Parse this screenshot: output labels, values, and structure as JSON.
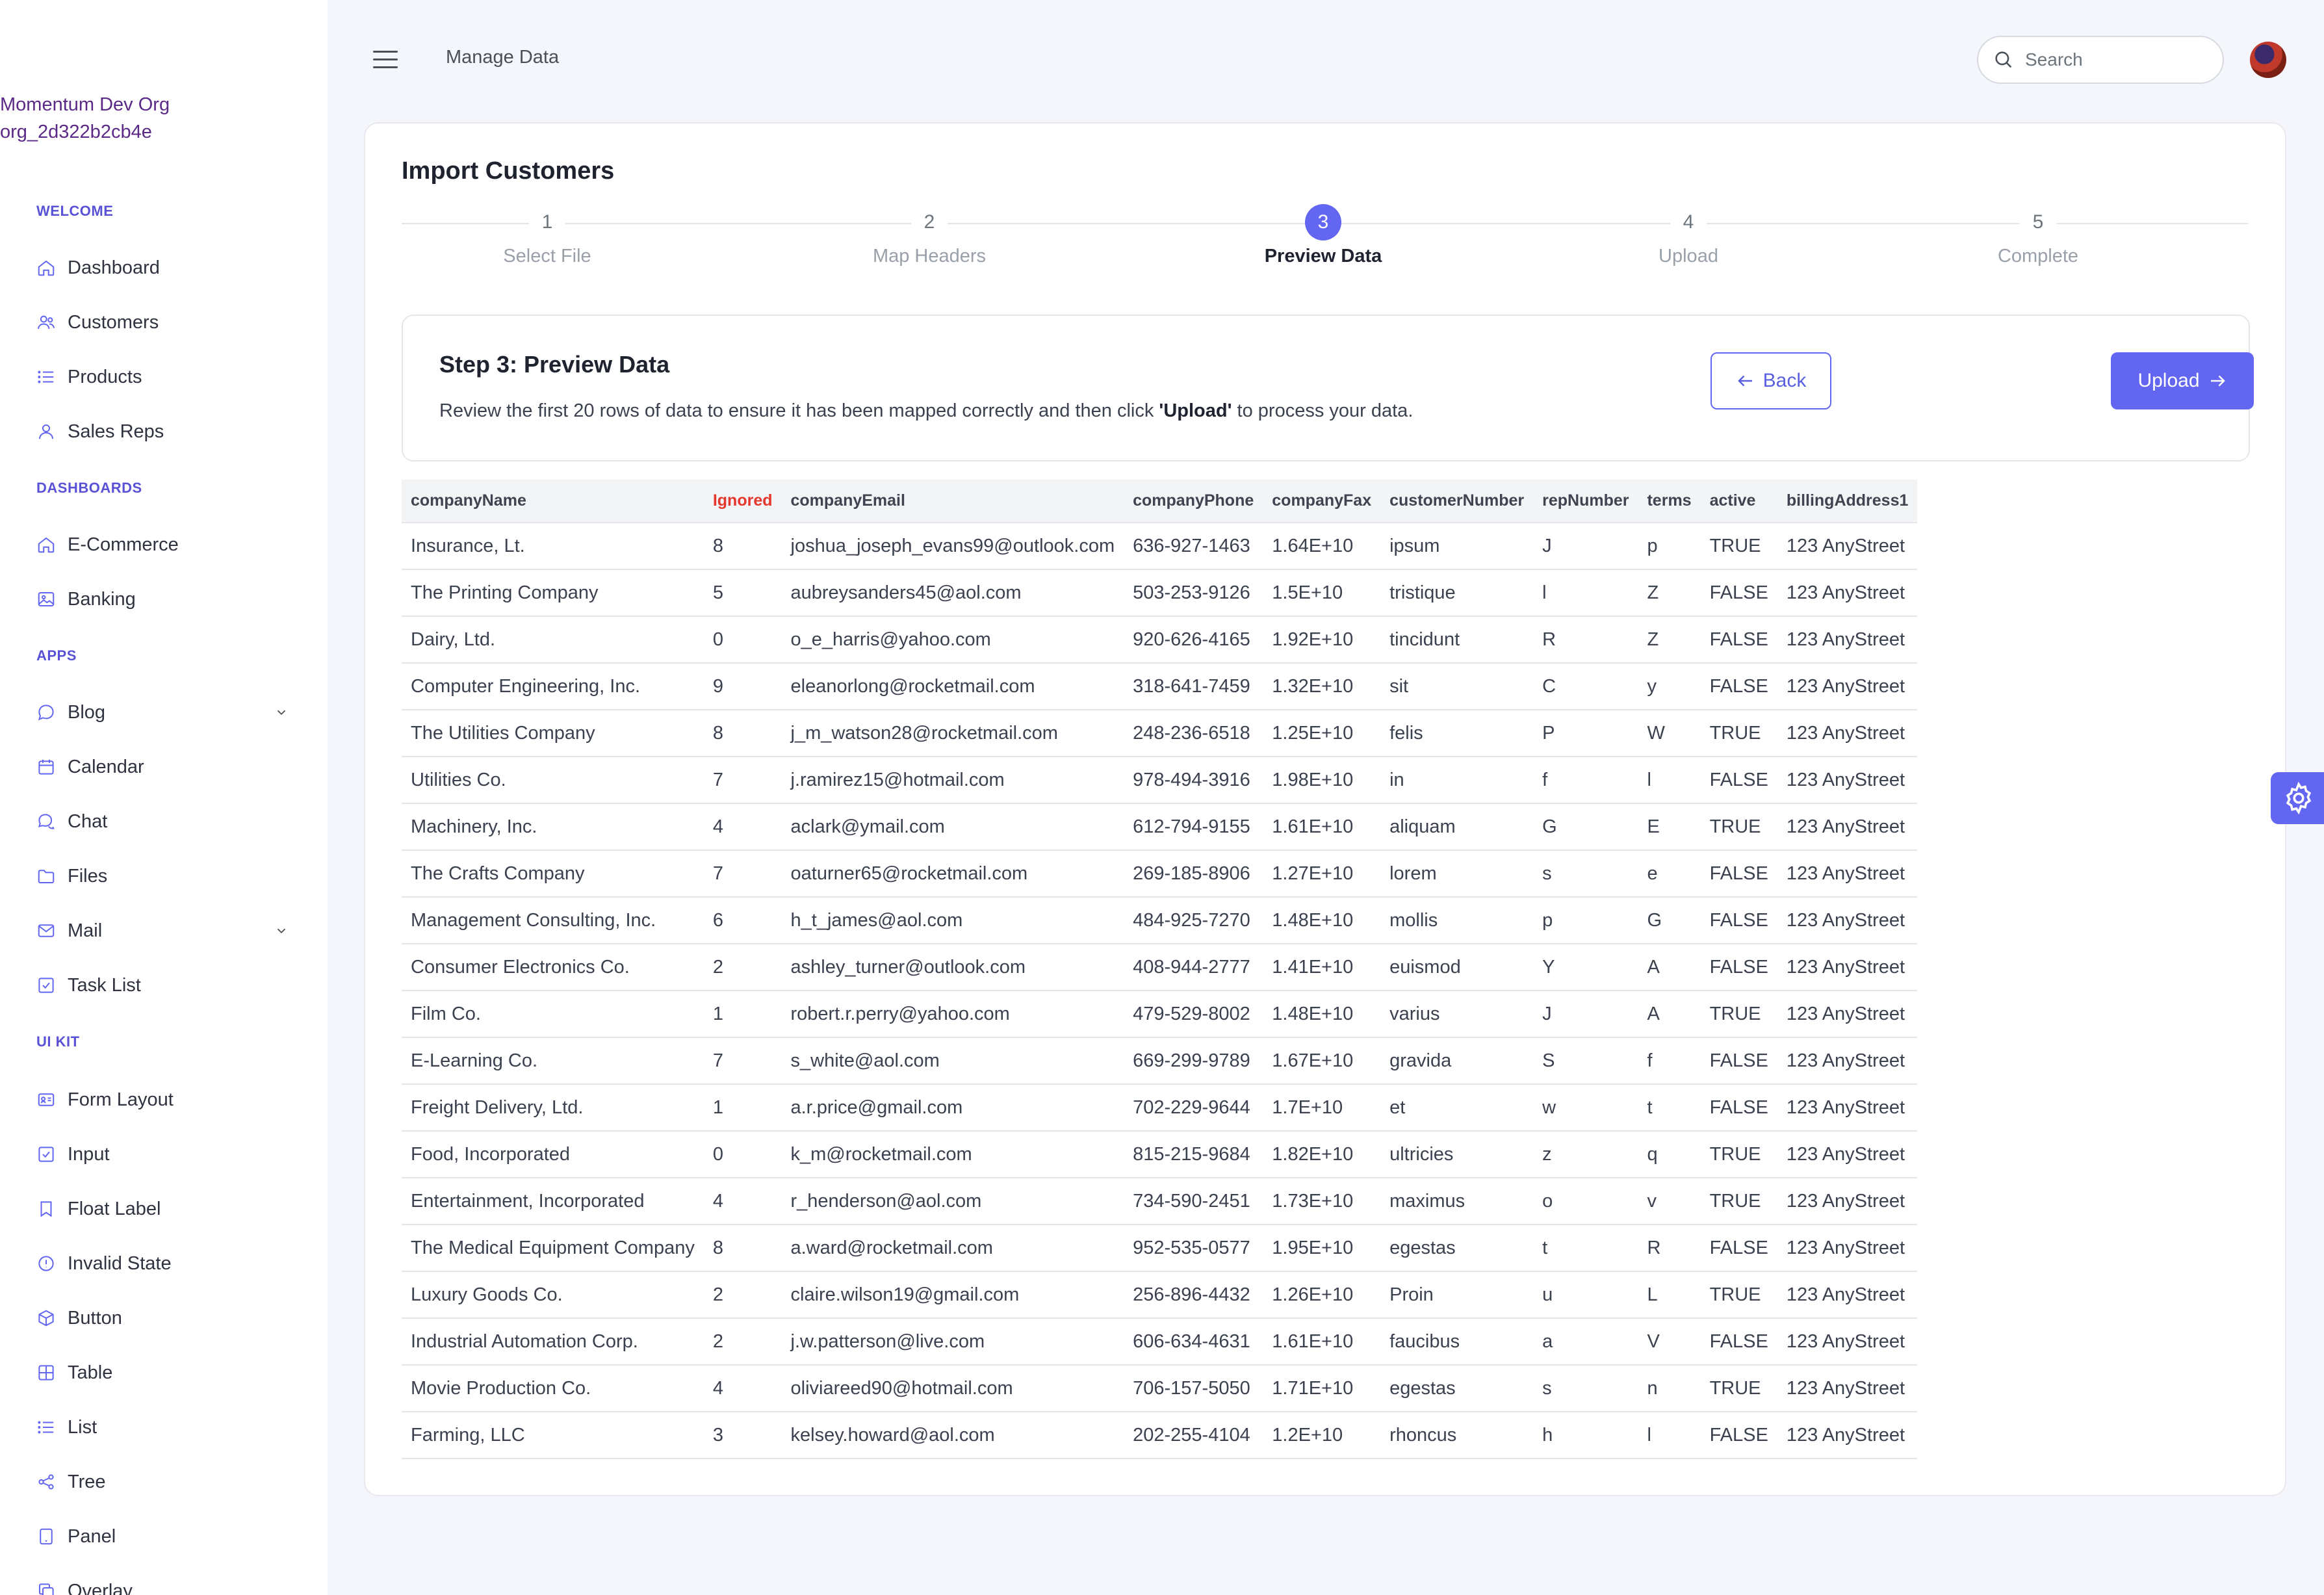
{
  "org": {
    "name": "Momentum Dev Org",
    "id": "org_2d322b2cb4e"
  },
  "sidebar": {
    "sections": [
      {
        "title": "WELCOME",
        "items": [
          {
            "label": "Dashboard",
            "icon": "home-icon"
          },
          {
            "label": "Customers",
            "icon": "users-icon"
          },
          {
            "label": "Products",
            "icon": "list-icon"
          },
          {
            "label": "Sales Reps",
            "icon": "user-icon"
          }
        ]
      },
      {
        "title": "DASHBOARDS",
        "items": [
          {
            "label": "E-Commerce",
            "icon": "home-icon"
          },
          {
            "label": "Banking",
            "icon": "image-icon"
          }
        ]
      },
      {
        "title": "APPS",
        "items": [
          {
            "label": "Blog",
            "icon": "comment-icon",
            "expandable": true
          },
          {
            "label": "Calendar",
            "icon": "calendar-icon"
          },
          {
            "label": "Chat",
            "icon": "chat-icon"
          },
          {
            "label": "Files",
            "icon": "folder-icon"
          },
          {
            "label": "Mail",
            "icon": "mail-icon",
            "expandable": true
          },
          {
            "label": "Task List",
            "icon": "check-square-icon"
          }
        ]
      },
      {
        "title": "UI KIT",
        "items": [
          {
            "label": "Form Layout",
            "icon": "id-card-icon"
          },
          {
            "label": "Input",
            "icon": "check-square-icon"
          },
          {
            "label": "Float Label",
            "icon": "bookmark-icon"
          },
          {
            "label": "Invalid State",
            "icon": "exclamation-circle-icon"
          },
          {
            "label": "Button",
            "icon": "box-icon"
          },
          {
            "label": "Table",
            "icon": "table-icon"
          },
          {
            "label": "List",
            "icon": "list-icon"
          },
          {
            "label": "Tree",
            "icon": "share-icon"
          },
          {
            "label": "Panel",
            "icon": "tablet-icon"
          },
          {
            "label": "Overlay",
            "icon": "clone-icon"
          }
        ]
      }
    ]
  },
  "topbar": {
    "title": "Manage Data",
    "search_placeholder": "Search"
  },
  "card": {
    "title": "Import Customers"
  },
  "steps": [
    {
      "num": "1",
      "label": "Select File"
    },
    {
      "num": "2",
      "label": "Map Headers"
    },
    {
      "num": "3",
      "label": "Preview Data",
      "active": true
    },
    {
      "num": "4",
      "label": "Upload"
    },
    {
      "num": "5",
      "label": "Complete"
    }
  ],
  "info": {
    "title": "Step 3: Preview Data",
    "desc_before": "Review the first 20 rows of data to ensure it has been mapped correctly and then click ",
    "desc_bold": "'Upload'",
    "desc_after": " to process your data.",
    "back_label": "Back",
    "upload_label": "Upload"
  },
  "colors": {
    "accent": "#6366f1",
    "ignored": "#e5372e",
    "org_text": "#5b2a86",
    "section_title": "#5a52d6"
  },
  "table": {
    "columns": [
      "companyName",
      "Ignored",
      "companyEmail",
      "companyPhone",
      "companyFax",
      "customerNumber",
      "repNumber",
      "terms",
      "active",
      "billingAddress1"
    ],
    "rows": [
      [
        "Insurance, Lt.",
        "8",
        "joshua_joseph_evans99@outlook.com",
        "636-927-1463",
        "1.64E+10",
        "ipsum",
        "J",
        "p",
        "TRUE",
        "123 AnyStreet"
      ],
      [
        "The Printing Company",
        "5",
        "aubreysanders45@aol.com",
        "503-253-9126",
        "1.5E+10",
        "tristique",
        "l",
        "Z",
        "FALSE",
        "123 AnyStreet"
      ],
      [
        "Dairy, Ltd.",
        "0",
        "o_e_harris@yahoo.com",
        "920-626-4165",
        "1.92E+10",
        "tincidunt",
        "R",
        "Z",
        "FALSE",
        "123 AnyStreet"
      ],
      [
        "Computer Engineering, Inc.",
        "9",
        "eleanorlong@rocketmail.com",
        "318-641-7459",
        "1.32E+10",
        "sit",
        "C",
        "y",
        "FALSE",
        "123 AnyStreet"
      ],
      [
        "The Utilities Company",
        "8",
        "j_m_watson28@rocketmail.com",
        "248-236-6518",
        "1.25E+10",
        "felis",
        "P",
        "W",
        "TRUE",
        "123 AnyStreet"
      ],
      [
        "Utilities Co.",
        "7",
        "j.ramirez15@hotmail.com",
        "978-494-3916",
        "1.98E+10",
        "in",
        "f",
        "l",
        "FALSE",
        "123 AnyStreet"
      ],
      [
        "Machinery, Inc.",
        "4",
        "aclark@ymail.com",
        "612-794-9155",
        "1.61E+10",
        "aliquam",
        "G",
        "E",
        "TRUE",
        "123 AnyStreet"
      ],
      [
        "The Crafts Company",
        "7",
        "oaturner65@rocketmail.com",
        "269-185-8906",
        "1.27E+10",
        "lorem",
        "s",
        "e",
        "FALSE",
        "123 AnyStreet"
      ],
      [
        "Management Consulting, Inc.",
        "6",
        "h_t_james@aol.com",
        "484-925-7270",
        "1.48E+10",
        "mollis",
        "p",
        "G",
        "FALSE",
        "123 AnyStreet"
      ],
      [
        "Consumer Electronics Co.",
        "2",
        "ashley_turner@outlook.com",
        "408-944-2777",
        "1.41E+10",
        "euismod",
        "Y",
        "A",
        "FALSE",
        "123 AnyStreet"
      ],
      [
        "Film Co.",
        "1",
        "robert.r.perry@yahoo.com",
        "479-529-8002",
        "1.48E+10",
        "varius",
        "J",
        "A",
        "TRUE",
        "123 AnyStreet"
      ],
      [
        "E-Learning Co.",
        "7",
        "s_white@aol.com",
        "669-299-9789",
        "1.67E+10",
        "gravida",
        "S",
        "f",
        "FALSE",
        "123 AnyStreet"
      ],
      [
        "Freight Delivery, Ltd.",
        "1",
        "a.r.price@gmail.com",
        "702-229-9644",
        "1.7E+10",
        "et",
        "w",
        "t",
        "FALSE",
        "123 AnyStreet"
      ],
      [
        "Food, Incorporated",
        "0",
        "k_m@rocketmail.com",
        "815-215-9684",
        "1.82E+10",
        "ultricies",
        "z",
        "q",
        "TRUE",
        "123 AnyStreet"
      ],
      [
        "Entertainment, Incorporated",
        "4",
        "r_henderson@aol.com",
        "734-590-2451",
        "1.73E+10",
        "maximus",
        "o",
        "v",
        "TRUE",
        "123 AnyStreet"
      ],
      [
        "The Medical Equipment Company",
        "8",
        "a.ward@rocketmail.com",
        "952-535-0577",
        "1.95E+10",
        "egestas",
        "t",
        "R",
        "FALSE",
        "123 AnyStreet"
      ],
      [
        "Luxury Goods Co.",
        "2",
        "claire.wilson19@gmail.com",
        "256-896-4432",
        "1.26E+10",
        "Proin",
        "u",
        "L",
        "TRUE",
        "123 AnyStreet"
      ],
      [
        "Industrial Automation Corp.",
        "2",
        "j.w.patterson@live.com",
        "606-634-4631",
        "1.61E+10",
        "faucibus",
        "a",
        "V",
        "FALSE",
        "123 AnyStreet"
      ],
      [
        "Movie Production Co.",
        "4",
        "oliviareed90@hotmail.com",
        "706-157-5050",
        "1.71E+10",
        "egestas",
        "s",
        "n",
        "TRUE",
        "123 AnyStreet"
      ],
      [
        "Farming, LLC",
        "3",
        "kelsey.howard@aol.com",
        "202-255-4104",
        "1.2E+10",
        "rhoncus",
        "h",
        "l",
        "FALSE",
        "123 AnyStreet"
      ]
    ]
  }
}
